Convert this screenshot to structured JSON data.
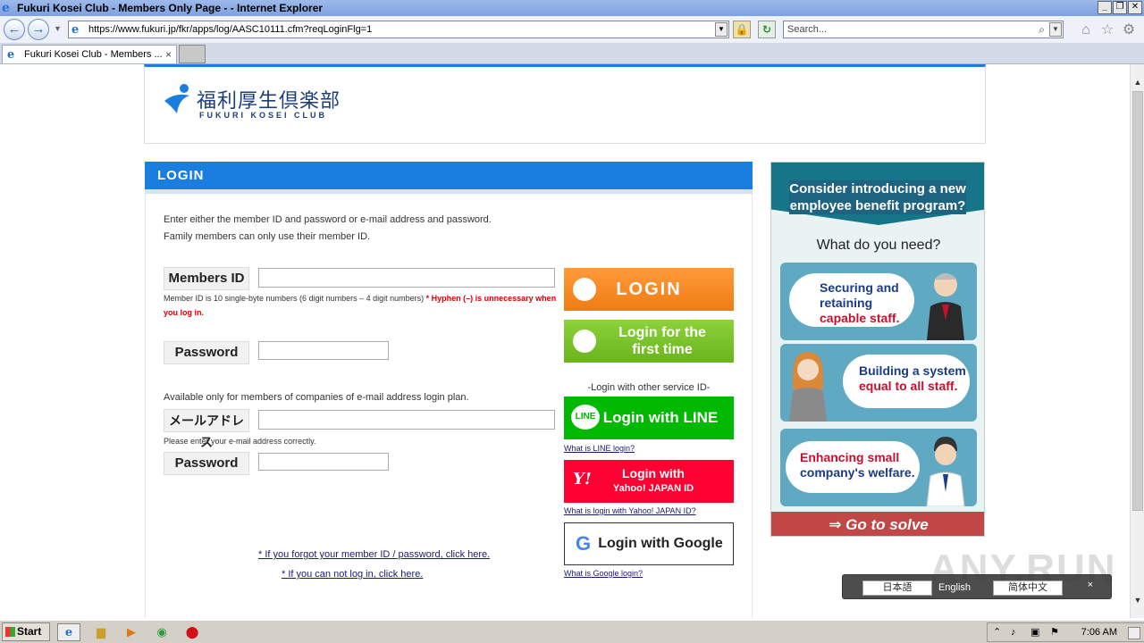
{
  "browser": {
    "title": "Fukuri Kosei Club - Members Only Page - - Internet Explorer",
    "url": "https://www.fukuri.jp/fkr/apps/log/AASC10111.cfm?reqLoginFlg=1",
    "search_placeholder": "Search...",
    "tab_label": "Fukuri Kosei Club - Members ...",
    "tab_close": "×"
  },
  "header": {
    "logo_jp": "福利厚生倶楽部",
    "logo_en": "FUKURI KOSEI CLUB"
  },
  "login": {
    "heading": "LOGIN",
    "intro_line1": "Enter either the member ID and password or e-mail address and password.",
    "intro_line2": "Family members can only use their member ID.",
    "members_id_label": "Members ID",
    "members_id_value": "",
    "member_note": "Member ID is 10 single-byte numbers (6 digit numbers – 4 digit numbers)",
    "member_note_red": "* Hyphen (–) is unnecessary when you log in.",
    "password_label": "Password",
    "password_value": "",
    "email_intro": "Available only for members of companies of e-mail address login plan.",
    "email_label": "メールアドレス",
    "email_value": "",
    "email_note": "Please enter your e-mail address correctly.",
    "password2_label": "Password",
    "forgot_link": "* If you forgot your member ID / password, click here.",
    "cannot_login_link": "* If you can not log in, click here."
  },
  "buttons": {
    "login": "LOGIN",
    "first_time_line1": "Login for the",
    "first_time_line2": "first time",
    "other_service": "-Login with other service ID-",
    "line": "Login with LINE",
    "line_badge": "LINE",
    "line_help": "What is LINE login?",
    "yahoo_line1": "Login with",
    "yahoo_line2": "Yahoo! JAPAN ID",
    "yahoo_mark": "Y!",
    "yahoo_help": "What is login with Yahoo! JAPAN ID?",
    "google": "Login with Google",
    "google_mark": "G",
    "google_help": "What is Google login?"
  },
  "ad": {
    "headline": "Consider introducing a new employee benefit program?",
    "question": "What do you need?",
    "card1_a": "Securing and retaining",
    "card1_b": "capable staff.",
    "card2_a": "Building a system",
    "card2_b": "equal to all staff.",
    "card3_a": "Enhancing small",
    "card3_b": "company's welfare.",
    "cta": "⇒ Go to solve"
  },
  "language_bar": {
    "ja": "日本語",
    "en": "English",
    "zh": "简体中文",
    "close": "×"
  },
  "watermark": "ANY.RUN",
  "taskbar": {
    "start": "Start",
    "clock": "7:06 AM"
  },
  "colors": {
    "brand_blue": "#1a7ee0",
    "login_orange": "#f07c12",
    "first_green": "#6ab41e",
    "line_green": "#00b900",
    "yahoo_red": "#ff0033",
    "ad_teal": "#17758a",
    "ad_red": "#c24848"
  }
}
